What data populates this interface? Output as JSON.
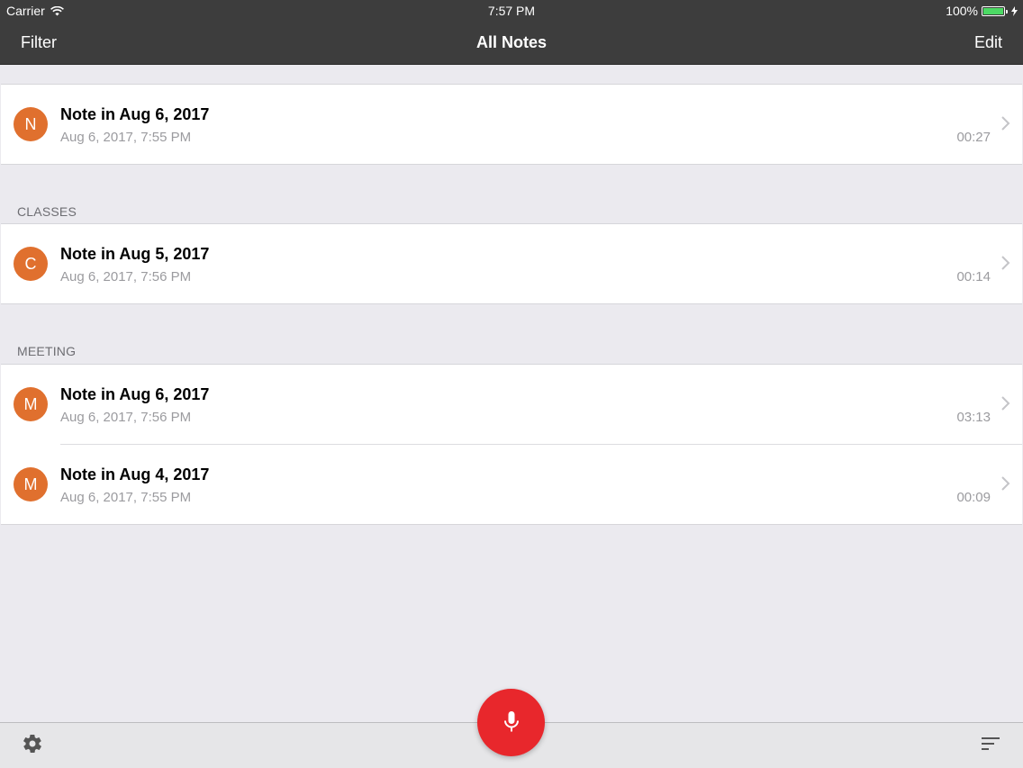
{
  "status_bar": {
    "carrier": "Carrier",
    "time": "7:57 PM",
    "battery": "100%"
  },
  "nav": {
    "left": "Filter",
    "title": "All Notes",
    "right": "Edit"
  },
  "sections": [
    {
      "header": "",
      "rows": [
        {
          "avatar": "N",
          "title": "Note in Aug 6, 2017",
          "subtitle": "Aug 6, 2017, 7:55 PM",
          "duration": "00:27"
        }
      ]
    },
    {
      "header": "CLASSES",
      "rows": [
        {
          "avatar": "C",
          "title": "Note in Aug 5, 2017",
          "subtitle": "Aug 6, 2017, 7:56 PM",
          "duration": "00:14"
        }
      ]
    },
    {
      "header": "MEETING",
      "rows": [
        {
          "avatar": "M",
          "title": "Note in Aug 6, 2017",
          "subtitle": "Aug 6, 2017, 7:56 PM",
          "duration": "03:13"
        },
        {
          "avatar": "M",
          "title": "Note in Aug 4, 2017",
          "subtitle": "Aug 6, 2017, 7:55 PM",
          "duration": "00:09"
        }
      ]
    }
  ],
  "toolbar": {
    "left_icon": "gear-icon",
    "center_icon": "microphone-icon",
    "right_icon": "sort-icon"
  },
  "colors": {
    "bar": "#3d3d3d",
    "avatar": "#e0702e",
    "record": "#e8272c",
    "battery": "#4cd964"
  }
}
